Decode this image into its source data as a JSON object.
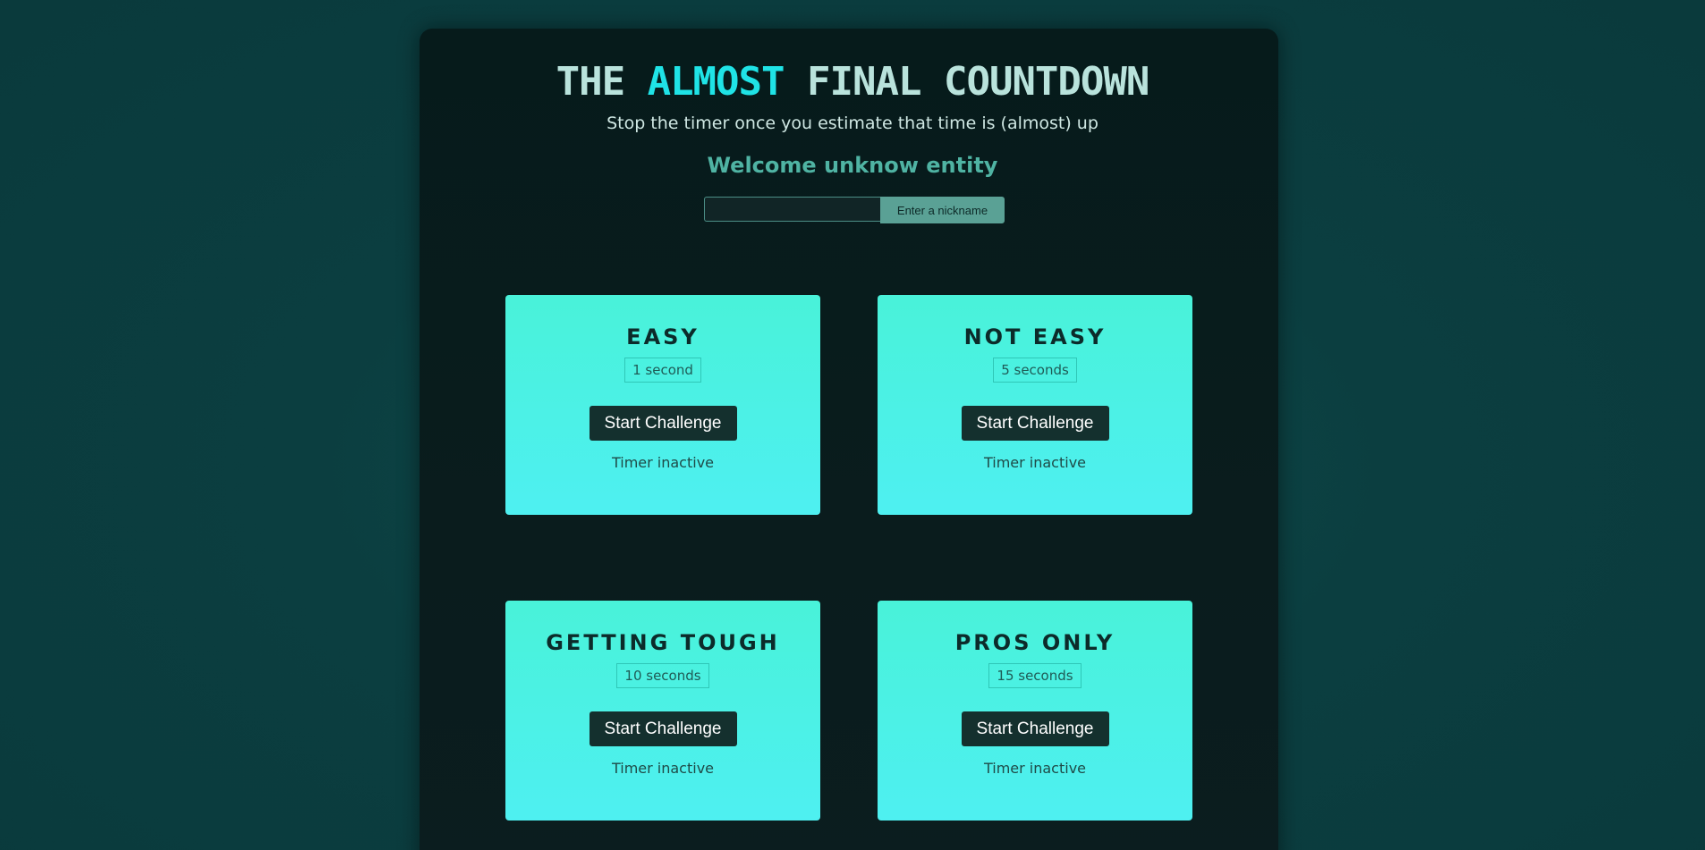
{
  "header": {
    "title_part1": "THE ",
    "title_accent": "ALMOST",
    "title_part2": " FINAL COUNTDOWN",
    "subtitle": "Stop the timer once you estimate that time is (almost) up",
    "welcome": "Welcome unknow entity"
  },
  "nickname": {
    "value": "",
    "placeholder": "",
    "button_label": "Enter a nickname"
  },
  "challenges": [
    {
      "title": "EASY",
      "duration": "1 second",
      "button_label": "Start Challenge",
      "status": "Timer inactive"
    },
    {
      "title": "NOT EASY",
      "duration": "5 seconds",
      "button_label": "Start Challenge",
      "status": "Timer inactive"
    },
    {
      "title": "GETTING TOUGH",
      "duration": "10 seconds",
      "button_label": "Start Challenge",
      "status": "Timer inactive"
    },
    {
      "title": "PROS ONLY",
      "duration": "15 seconds",
      "button_label": "Start Challenge",
      "status": "Timer inactive"
    }
  ],
  "colors": {
    "accent": "#1fe3e6",
    "card": "#4ef0e6",
    "button": "#14302e"
  }
}
